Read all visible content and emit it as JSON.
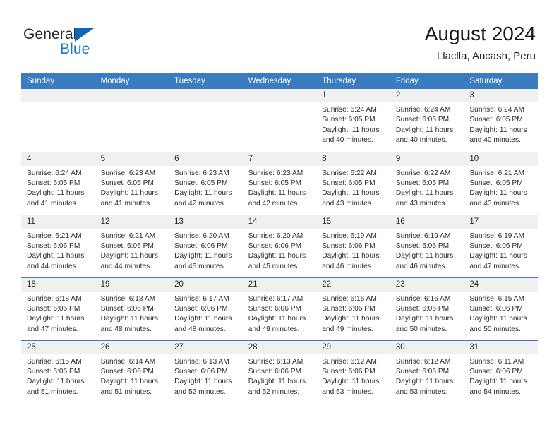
{
  "brand": {
    "word1": "General",
    "word2": "Blue",
    "triangle_color": "#1266b5",
    "word2_color": "#1876cf"
  },
  "header": {
    "title": "August 2024",
    "subtitle": "Llaclla, Ancash, Peru"
  },
  "theme": {
    "header_bg": "#3a7cbe",
    "header_text": "#ffffff",
    "daynum_bg": "#f0f0f0",
    "row_divider": "#3a7cbe",
    "body_text": "#2b2b2b"
  },
  "weekdays": [
    "Sunday",
    "Monday",
    "Tuesday",
    "Wednesday",
    "Thursday",
    "Friday",
    "Saturday"
  ],
  "labels": {
    "sunrise_prefix": "Sunrise:",
    "sunset_prefix": "Sunset:",
    "daylight_prefix": "Daylight:"
  },
  "weeks": [
    [
      {
        "day": "",
        "empty": true
      },
      {
        "day": "",
        "empty": true
      },
      {
        "day": "",
        "empty": true
      },
      {
        "day": "",
        "empty": true
      },
      {
        "day": "1",
        "sunrise": "Sunrise: 6:24 AM",
        "sunset": "Sunset: 6:05 PM",
        "daylight_l1": "Daylight: 11 hours",
        "daylight_l2": "and 40 minutes."
      },
      {
        "day": "2",
        "sunrise": "Sunrise: 6:24 AM",
        "sunset": "Sunset: 6:05 PM",
        "daylight_l1": "Daylight: 11 hours",
        "daylight_l2": "and 40 minutes."
      },
      {
        "day": "3",
        "sunrise": "Sunrise: 6:24 AM",
        "sunset": "Sunset: 6:05 PM",
        "daylight_l1": "Daylight: 11 hours",
        "daylight_l2": "and 40 minutes."
      }
    ],
    [
      {
        "day": "4",
        "sunrise": "Sunrise: 6:24 AM",
        "sunset": "Sunset: 6:05 PM",
        "daylight_l1": "Daylight: 11 hours",
        "daylight_l2": "and 41 minutes."
      },
      {
        "day": "5",
        "sunrise": "Sunrise: 6:23 AM",
        "sunset": "Sunset: 6:05 PM",
        "daylight_l1": "Daylight: 11 hours",
        "daylight_l2": "and 41 minutes."
      },
      {
        "day": "6",
        "sunrise": "Sunrise: 6:23 AM",
        "sunset": "Sunset: 6:05 PM",
        "daylight_l1": "Daylight: 11 hours",
        "daylight_l2": "and 42 minutes."
      },
      {
        "day": "7",
        "sunrise": "Sunrise: 6:23 AM",
        "sunset": "Sunset: 6:05 PM",
        "daylight_l1": "Daylight: 11 hours",
        "daylight_l2": "and 42 minutes."
      },
      {
        "day": "8",
        "sunrise": "Sunrise: 6:22 AM",
        "sunset": "Sunset: 6:05 PM",
        "daylight_l1": "Daylight: 11 hours",
        "daylight_l2": "and 43 minutes."
      },
      {
        "day": "9",
        "sunrise": "Sunrise: 6:22 AM",
        "sunset": "Sunset: 6:05 PM",
        "daylight_l1": "Daylight: 11 hours",
        "daylight_l2": "and 43 minutes."
      },
      {
        "day": "10",
        "sunrise": "Sunrise: 6:21 AM",
        "sunset": "Sunset: 6:05 PM",
        "daylight_l1": "Daylight: 11 hours",
        "daylight_l2": "and 43 minutes."
      }
    ],
    [
      {
        "day": "11",
        "sunrise": "Sunrise: 6:21 AM",
        "sunset": "Sunset: 6:06 PM",
        "daylight_l1": "Daylight: 11 hours",
        "daylight_l2": "and 44 minutes."
      },
      {
        "day": "12",
        "sunrise": "Sunrise: 6:21 AM",
        "sunset": "Sunset: 6:06 PM",
        "daylight_l1": "Daylight: 11 hours",
        "daylight_l2": "and 44 minutes."
      },
      {
        "day": "13",
        "sunrise": "Sunrise: 6:20 AM",
        "sunset": "Sunset: 6:06 PM",
        "daylight_l1": "Daylight: 11 hours",
        "daylight_l2": "and 45 minutes."
      },
      {
        "day": "14",
        "sunrise": "Sunrise: 6:20 AM",
        "sunset": "Sunset: 6:06 PM",
        "daylight_l1": "Daylight: 11 hours",
        "daylight_l2": "and 45 minutes."
      },
      {
        "day": "15",
        "sunrise": "Sunrise: 6:19 AM",
        "sunset": "Sunset: 6:06 PM",
        "daylight_l1": "Daylight: 11 hours",
        "daylight_l2": "and 46 minutes."
      },
      {
        "day": "16",
        "sunrise": "Sunrise: 6:19 AM",
        "sunset": "Sunset: 6:06 PM",
        "daylight_l1": "Daylight: 11 hours",
        "daylight_l2": "and 46 minutes."
      },
      {
        "day": "17",
        "sunrise": "Sunrise: 6:19 AM",
        "sunset": "Sunset: 6:06 PM",
        "daylight_l1": "Daylight: 11 hours",
        "daylight_l2": "and 47 minutes."
      }
    ],
    [
      {
        "day": "18",
        "sunrise": "Sunrise: 6:18 AM",
        "sunset": "Sunset: 6:06 PM",
        "daylight_l1": "Daylight: 11 hours",
        "daylight_l2": "and 47 minutes."
      },
      {
        "day": "19",
        "sunrise": "Sunrise: 6:18 AM",
        "sunset": "Sunset: 6:06 PM",
        "daylight_l1": "Daylight: 11 hours",
        "daylight_l2": "and 48 minutes."
      },
      {
        "day": "20",
        "sunrise": "Sunrise: 6:17 AM",
        "sunset": "Sunset: 6:06 PM",
        "daylight_l1": "Daylight: 11 hours",
        "daylight_l2": "and 48 minutes."
      },
      {
        "day": "21",
        "sunrise": "Sunrise: 6:17 AM",
        "sunset": "Sunset: 6:06 PM",
        "daylight_l1": "Daylight: 11 hours",
        "daylight_l2": "and 49 minutes."
      },
      {
        "day": "22",
        "sunrise": "Sunrise: 6:16 AM",
        "sunset": "Sunset: 6:06 PM",
        "daylight_l1": "Daylight: 11 hours",
        "daylight_l2": "and 49 minutes."
      },
      {
        "day": "23",
        "sunrise": "Sunrise: 6:16 AM",
        "sunset": "Sunset: 6:06 PM",
        "daylight_l1": "Daylight: 11 hours",
        "daylight_l2": "and 50 minutes."
      },
      {
        "day": "24",
        "sunrise": "Sunrise: 6:15 AM",
        "sunset": "Sunset: 6:06 PM",
        "daylight_l1": "Daylight: 11 hours",
        "daylight_l2": "and 50 minutes."
      }
    ],
    [
      {
        "day": "25",
        "sunrise": "Sunrise: 6:15 AM",
        "sunset": "Sunset: 6:06 PM",
        "daylight_l1": "Daylight: 11 hours",
        "daylight_l2": "and 51 minutes."
      },
      {
        "day": "26",
        "sunrise": "Sunrise: 6:14 AM",
        "sunset": "Sunset: 6:06 PM",
        "daylight_l1": "Daylight: 11 hours",
        "daylight_l2": "and 51 minutes."
      },
      {
        "day": "27",
        "sunrise": "Sunrise: 6:13 AM",
        "sunset": "Sunset: 6:06 PM",
        "daylight_l1": "Daylight: 11 hours",
        "daylight_l2": "and 52 minutes."
      },
      {
        "day": "28",
        "sunrise": "Sunrise: 6:13 AM",
        "sunset": "Sunset: 6:06 PM",
        "daylight_l1": "Daylight: 11 hours",
        "daylight_l2": "and 52 minutes."
      },
      {
        "day": "29",
        "sunrise": "Sunrise: 6:12 AM",
        "sunset": "Sunset: 6:06 PM",
        "daylight_l1": "Daylight: 11 hours",
        "daylight_l2": "and 53 minutes."
      },
      {
        "day": "30",
        "sunrise": "Sunrise: 6:12 AM",
        "sunset": "Sunset: 6:06 PM",
        "daylight_l1": "Daylight: 11 hours",
        "daylight_l2": "and 53 minutes."
      },
      {
        "day": "31",
        "sunrise": "Sunrise: 6:11 AM",
        "sunset": "Sunset: 6:06 PM",
        "daylight_l1": "Daylight: 11 hours",
        "daylight_l2": "and 54 minutes."
      }
    ]
  ]
}
